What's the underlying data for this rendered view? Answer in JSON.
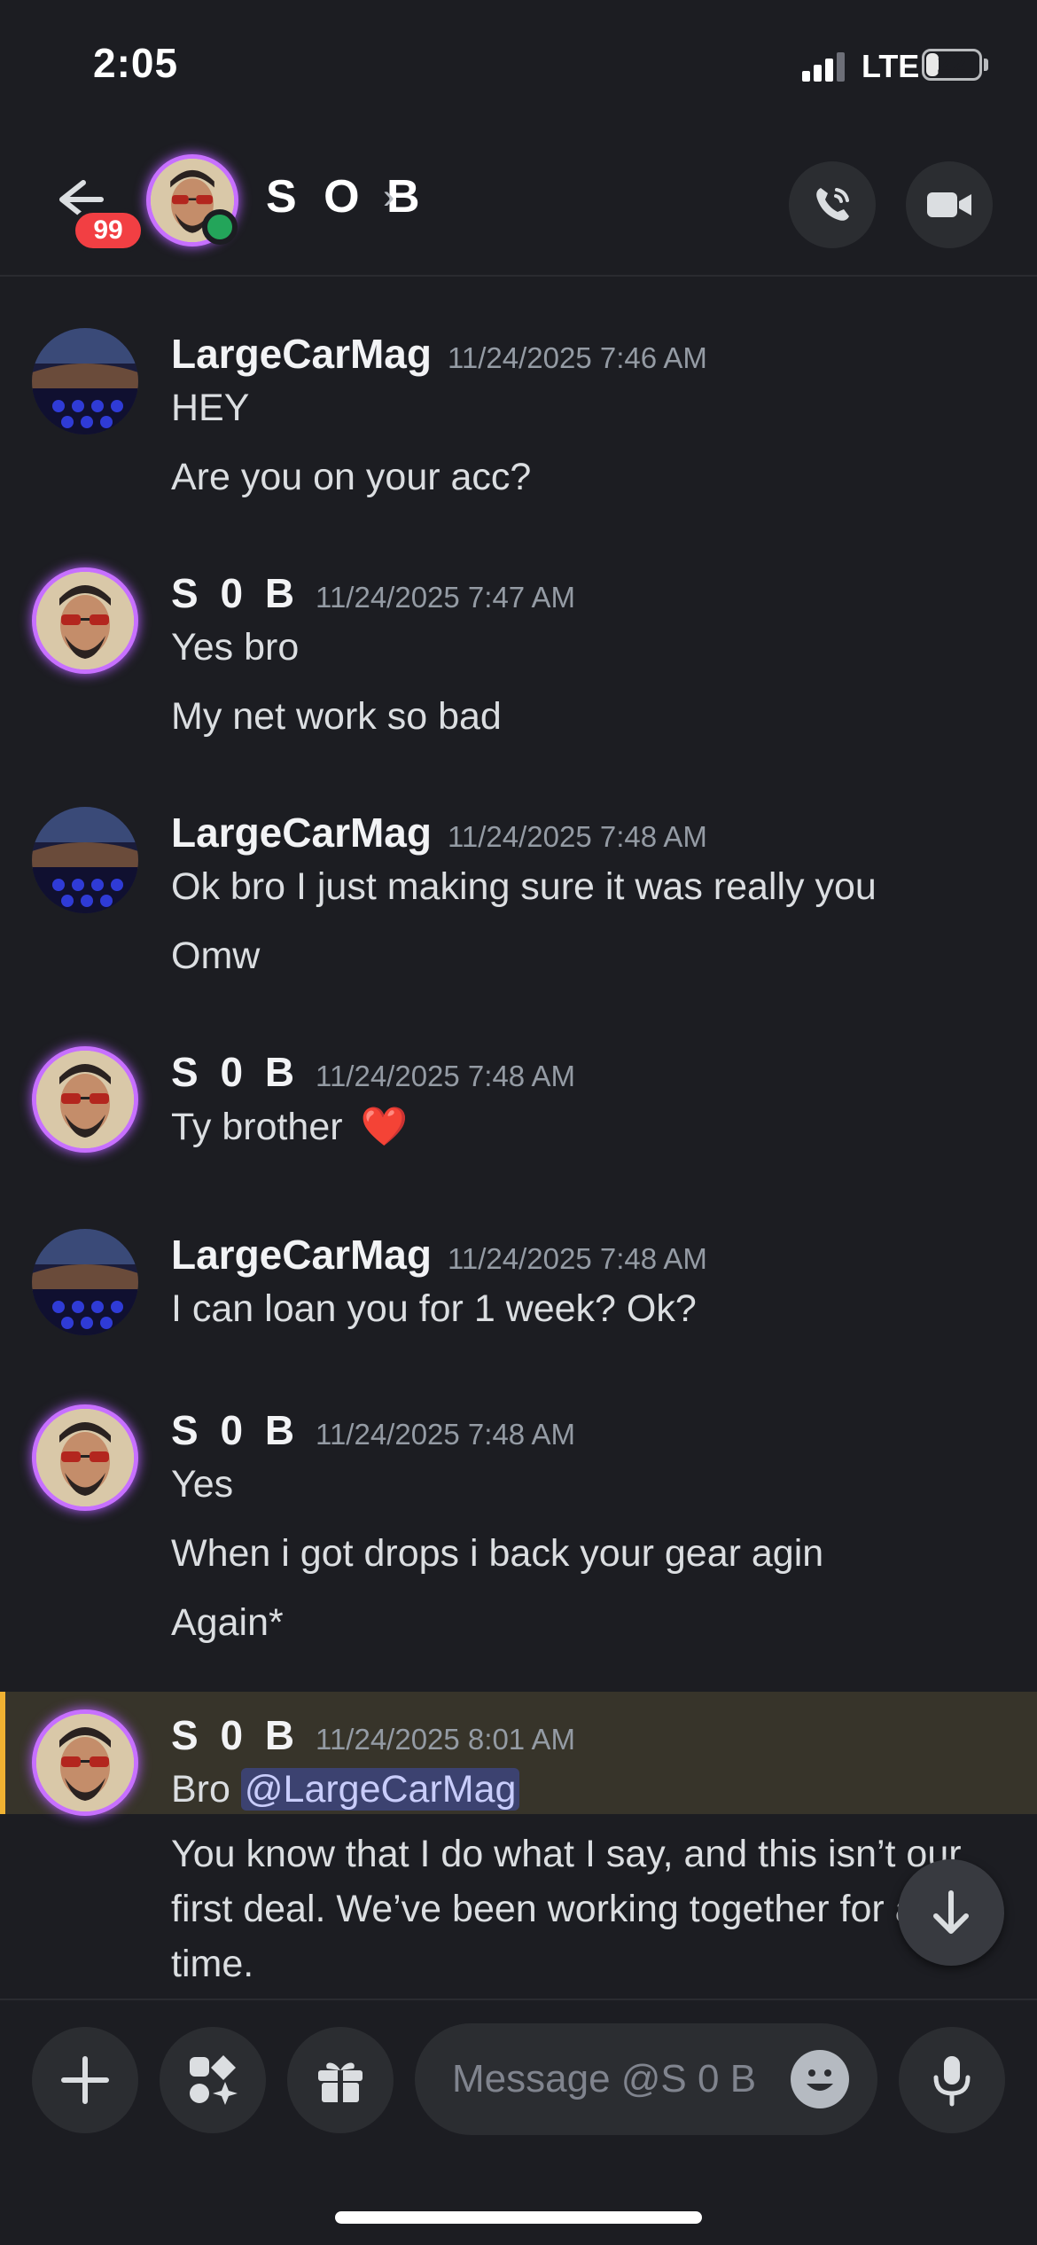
{
  "status_bar": {
    "time": "2:05",
    "network": "LTE",
    "battery": "22",
    "battery_level": 0.22
  },
  "header": {
    "back_badge": "99",
    "name": "S O B",
    "chevron": "›"
  },
  "messages": [
    {
      "author": "LargeCarMag",
      "time": "11/24/2025 7:46 AM",
      "lines": [
        "HEY",
        "Are you on your acc?"
      ]
    },
    {
      "author": "S 0 B",
      "time": "11/24/2025 7:47 AM",
      "lines": [
        "Yes bro",
        "My net work so bad"
      ]
    },
    {
      "author": "LargeCarMag",
      "time": "11/24/2025 7:48 AM",
      "lines": [
        "Ok bro I just making sure it was really you",
        "Omw"
      ]
    },
    {
      "author": "S 0 B",
      "time": "11/24/2025 7:48 AM",
      "lines": [
        "Ty brother"
      ],
      "emoji": "❤️"
    },
    {
      "author": "LargeCarMag",
      "time": "11/24/2025 7:48 AM",
      "lines": [
        "I can loan you for 1 week? Ok?"
      ]
    },
    {
      "author": "S 0 B",
      "time": "11/24/2025 7:48 AM",
      "lines": [
        "Yes",
        "When i got drops i back your gear agin",
        "Again*"
      ]
    },
    {
      "author": "S 0 B",
      "time": "11/24/2025 8:01 AM",
      "first_prefix": "Bro",
      "mention": "@LargeCarMag",
      "paragraph": "You know that I do what I say, and this isn’t our first deal. We’ve been working together for a long time."
    }
  ],
  "composer": {
    "placeholder": "Message @S 0 B"
  },
  "colors": {
    "background": "#1c1d22",
    "mention_bg": "#3c4270",
    "highlight_bar": "#f0b232",
    "online": "#23a55a",
    "badge": "#f23f43"
  },
  "icons": [
    "back-arrow-icon",
    "phone-icon",
    "video-camera-icon",
    "plus-icon",
    "apps-icon",
    "gift-icon",
    "emoji-icon",
    "microphone-icon",
    "arrow-down-icon"
  ]
}
